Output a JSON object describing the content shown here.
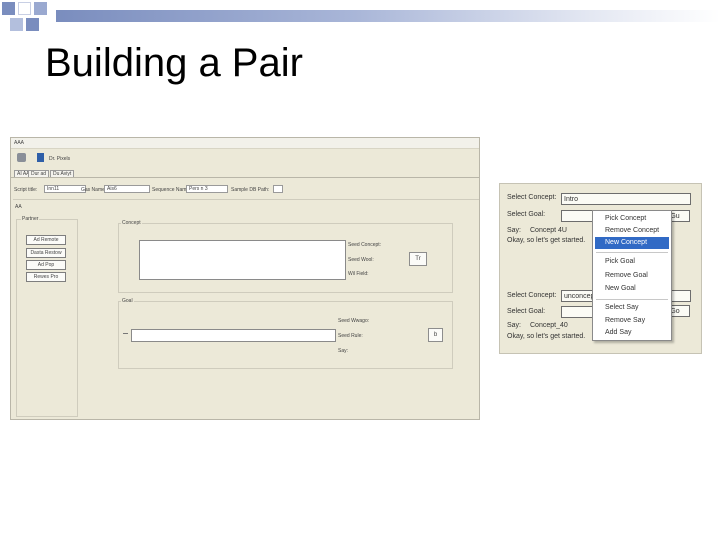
{
  "slide": {
    "title": "Building a Pair",
    "accent_colors": [
      "#7a8dbe",
      "#9aa9d0"
    ]
  },
  "editor": {
    "window_title": "AAA",
    "toolbar_label": "Dr. Pixels",
    "tabs": [
      "AI AA",
      "Dur ad",
      "Du Aviyt"
    ],
    "header_fields": [
      {
        "label": "Script title:",
        "value": "Inn11"
      },
      {
        "label": "Gas Name:",
        "value": "Ais6"
      },
      {
        "label": "Sequence Name:",
        "value": "Pers n 3"
      },
      {
        "label": "Sample DB Path:",
        "value": ""
      }
    ],
    "left_group_label": "Partner",
    "left_buttons": [
      "Ad Remote",
      "Dasta Restow",
      "Ad Pop",
      "Rewes Pro"
    ],
    "concept_group": {
      "label": "Concept",
      "labels": [
        "Seed Concept:",
        "Seed Wool:",
        "Wil Field:"
      ],
      "button": "Tr"
    },
    "goal_group": {
      "label": "Goal",
      "labels": [
        "Seed Wwago:",
        "Seed Rule:",
        "Say:"
      ],
      "button": "b"
    }
  },
  "concept_panel": {
    "rows_top": [
      {
        "label": "Select Concept:",
        "value": "Intro"
      },
      {
        "label": "Select Goal:",
        "value": ""
      }
    ],
    "say_top": {
      "label": "Say:",
      "value": "Concept 4U"
    },
    "okay_top": "Okay, so let's get started.",
    "goal_btn": "Gu",
    "rows_bottom": [
      {
        "label": "Select Concept:",
        "value": "unconcept"
      },
      {
        "label": "Select Goal:",
        "value": ""
      }
    ],
    "say_bottom": {
      "label": "Say:",
      "value": "Concept_40"
    },
    "okay_bottom": "Okay, so let's get started.",
    "goal_btn_bottom": "Go"
  },
  "context_menu": {
    "items": [
      "Pick Concept",
      "Remove Concept",
      "New Concept",
      "Pick Goal",
      "Remove Goal",
      "New Goal",
      "Select Say",
      "Remove Say",
      "Add Say"
    ],
    "selected_index": 2
  }
}
